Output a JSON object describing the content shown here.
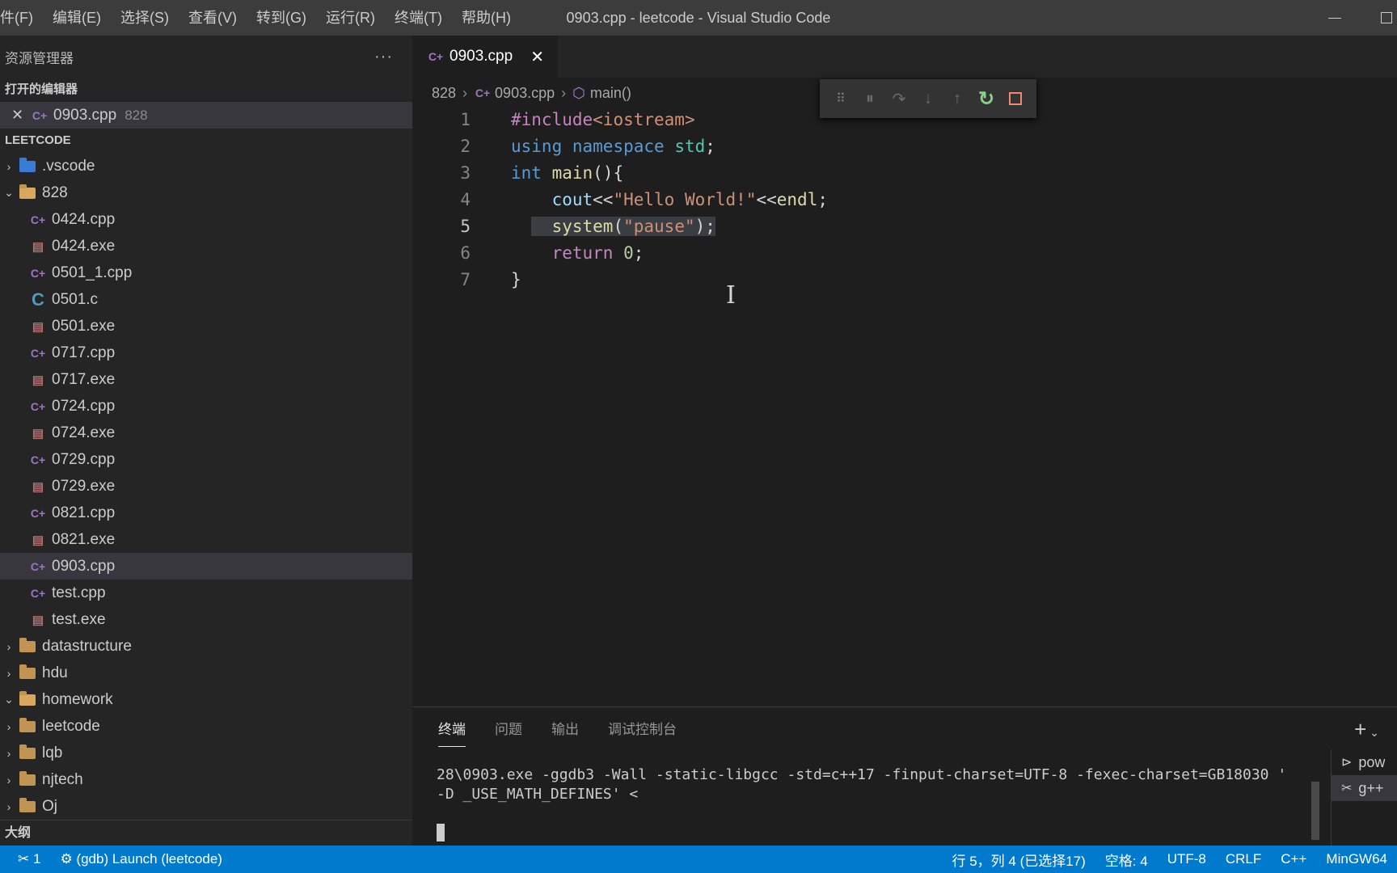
{
  "menu": [
    "件(F)",
    "编辑(E)",
    "选择(S)",
    "查看(V)",
    "转到(G)",
    "运行(R)",
    "终端(T)",
    "帮助(H)"
  ],
  "window_title": "0903.cpp - leetcode - Visual Studio Code",
  "sidebar": {
    "title": "资源管理器",
    "more": "···",
    "open_editors_header": "打开的编辑器",
    "open_editor": {
      "name": "0903.cpp",
      "folder": "828"
    },
    "workspace_header": "LEETCODE",
    "folder_vscode": ".vscode",
    "folder_828": "828",
    "files": [
      {
        "name": "0424.cpp",
        "type": "cpp"
      },
      {
        "name": "0424.exe",
        "type": "exe"
      },
      {
        "name": "0501_1.cpp",
        "type": "cpp"
      },
      {
        "name": "0501.c",
        "type": "c"
      },
      {
        "name": "0501.exe",
        "type": "exe"
      },
      {
        "name": "0717.cpp",
        "type": "cpp"
      },
      {
        "name": "0717.exe",
        "type": "exe"
      },
      {
        "name": "0724.cpp",
        "type": "cpp"
      },
      {
        "name": "0724.exe",
        "type": "exe"
      },
      {
        "name": "0729.cpp",
        "type": "cpp"
      },
      {
        "name": "0729.exe",
        "type": "exe"
      },
      {
        "name": "0821.cpp",
        "type": "cpp"
      },
      {
        "name": "0821.exe",
        "type": "exe"
      },
      {
        "name": "0903.cpp",
        "type": "cpp"
      },
      {
        "name": "test.cpp",
        "type": "cpp"
      },
      {
        "name": "test.exe",
        "type": "exe"
      }
    ],
    "folders": [
      "datastructure",
      "hdu",
      "homework",
      "leetcode",
      "lqb",
      "njtech",
      "Oj"
    ],
    "outline_header": "大纲"
  },
  "editor": {
    "tab": "0903.cpp",
    "breadcrumb": [
      "828",
      "0903.cpp",
      "main()"
    ],
    "line_numbers": [
      "1",
      "2",
      "3",
      "4",
      "5",
      "6",
      "7"
    ]
  },
  "panel": {
    "tabs": [
      "终端",
      "问题",
      "输出",
      "调试控制台"
    ],
    "terminal_line1": "28\\0903.exe -ggdb3 -Wall -static-libgcc -std=c++17 -finput-charset=UTF-8 -fexec-charset=GB18030 '",
    "terminal_line2": "-D _USE_MATH_DEFINES' <",
    "terminal_list": [
      "pow",
      "g++"
    ]
  },
  "status": {
    "debug_count": "1",
    "launch": "(gdb) Launch (leetcode)",
    "position": "行 5，列 4 (已选择17)",
    "spaces": "空格: 4",
    "encoding": "UTF-8",
    "eol": "CRLF",
    "language": "C++",
    "env": "MinGW64"
  },
  "colors": {
    "statusbar": "#007acc",
    "accent_restart": "#89d185",
    "accent_stop": "#f48771"
  }
}
